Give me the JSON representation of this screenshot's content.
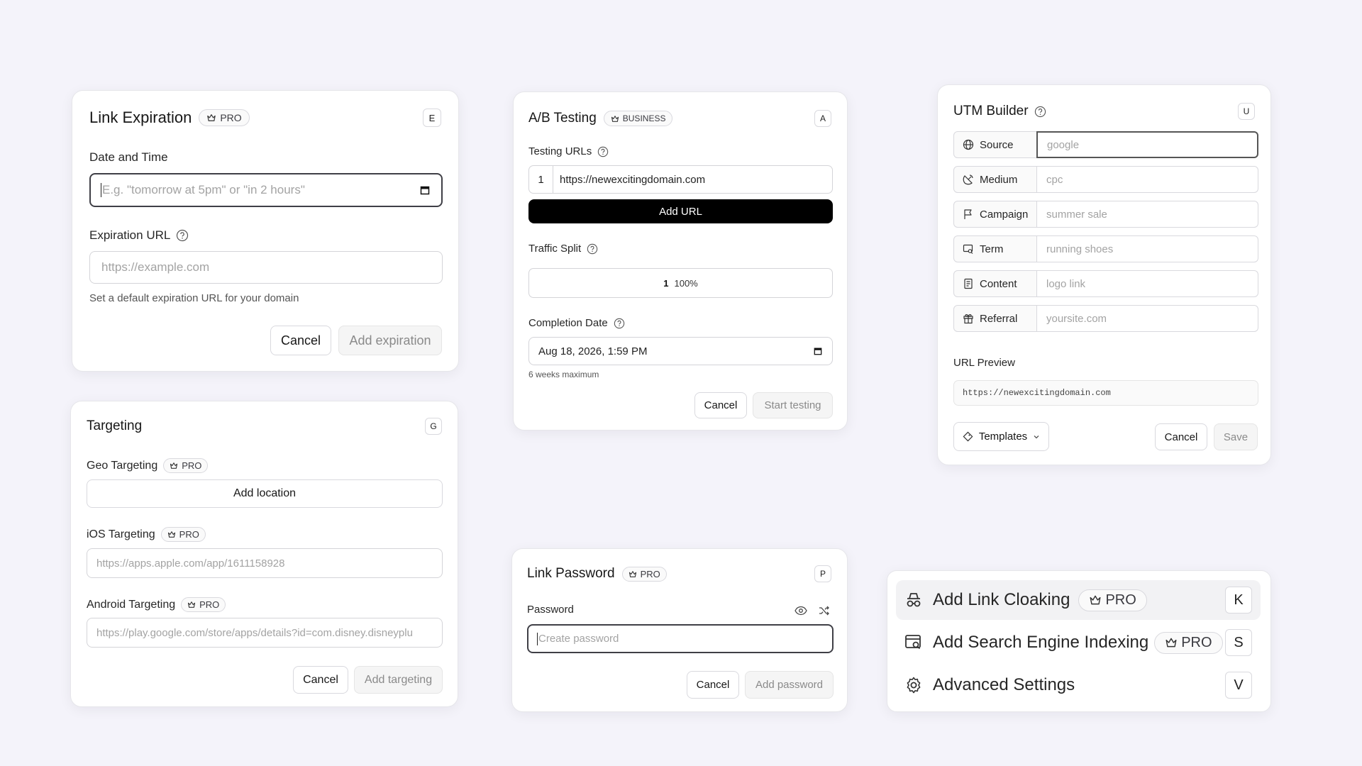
{
  "link_expiration": {
    "title": "Link Expiration",
    "badge": "PRO",
    "shortcut": "E",
    "date_label": "Date and Time",
    "date_placeholder": "E.g. \"tomorrow at 5pm\" or \"in 2 hours\"",
    "url_label": "Expiration URL",
    "url_placeholder": "https://example.com",
    "hint": "Set a default expiration URL for your domain",
    "cancel": "Cancel",
    "submit": "Add expiration"
  },
  "ab_testing": {
    "title": "A/B Testing",
    "badge": "BUSINESS",
    "shortcut": "A",
    "urls_label": "Testing URLs",
    "url_index": "1",
    "url_value": "https://newexcitingdomain.com",
    "add_url": "Add URL",
    "split_label": "Traffic Split",
    "split_index": "1",
    "split_value": "100%",
    "completion_label": "Completion Date",
    "completion_value": "Aug 18, 2026, 1:59 PM",
    "completion_hint": "6 weeks maximum",
    "cancel": "Cancel",
    "submit": "Start testing"
  },
  "utm_builder": {
    "title": "UTM Builder",
    "shortcut": "U",
    "rows": [
      {
        "label": "Source",
        "placeholder": "google",
        "icon": "globe-icon"
      },
      {
        "label": "Medium",
        "placeholder": "cpc",
        "icon": "satellite-icon"
      },
      {
        "label": "Campaign",
        "placeholder": "summer sale",
        "icon": "flag-icon"
      },
      {
        "label": "Term",
        "placeholder": "running shoes",
        "icon": "search-window-icon"
      },
      {
        "label": "Content",
        "placeholder": "logo link",
        "icon": "document-icon"
      },
      {
        "label": "Referral",
        "placeholder": "yoursite.com",
        "icon": "gift-icon"
      }
    ],
    "preview_label": "URL Preview",
    "preview_value": "https://newexcitingdomain.com",
    "templates": "Templates",
    "cancel": "Cancel",
    "save": "Save"
  },
  "targeting": {
    "title": "Targeting",
    "shortcut": "G",
    "geo_label": "Geo Targeting",
    "geo_badge": "PRO",
    "add_location": "Add location",
    "ios_label": "iOS Targeting",
    "ios_badge": "PRO",
    "ios_placeholder": "https://apps.apple.com/app/1611158928",
    "android_label": "Android Targeting",
    "android_badge": "PRO",
    "android_placeholder": "https://play.google.com/store/apps/details?id=com.disney.disneyplu",
    "cancel": "Cancel",
    "submit": "Add targeting"
  },
  "link_password": {
    "title": "Link Password",
    "badge": "PRO",
    "shortcut": "P",
    "password_label": "Password",
    "password_placeholder": "Create password",
    "cancel": "Cancel",
    "submit": "Add password"
  },
  "more_menu": {
    "items": [
      {
        "label": "Add Link Cloaking",
        "badge": "PRO",
        "shortcut": "K"
      },
      {
        "label": "Add Search Engine Indexing",
        "badge": "PRO",
        "shortcut": "S"
      },
      {
        "label": "Advanced Settings",
        "badge": "",
        "shortcut": "V"
      }
    ]
  }
}
